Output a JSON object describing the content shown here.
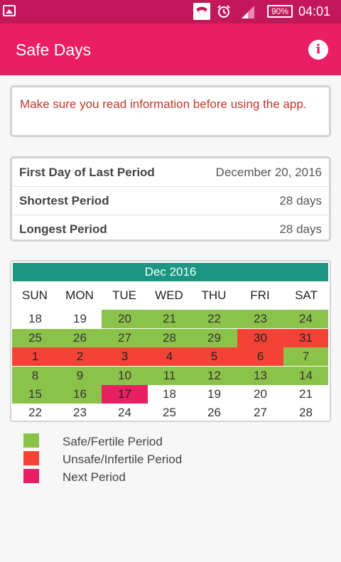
{
  "status_bar": {
    "battery": "90%",
    "time": "04:01",
    "icons": [
      "image-icon",
      "wifi-icon",
      "alarm-icon",
      "signal-icon",
      "battery-icon"
    ]
  },
  "app_bar": {
    "title": "Safe Days",
    "info_icon": "info-icon",
    "info_glyph": "i"
  },
  "notice": {
    "text": "Make sure you read information before using the app."
  },
  "details": [
    {
      "label": "First Day of Last Period",
      "value": "December 20, 2016"
    },
    {
      "label": "Shortest Period",
      "value": "28 days"
    },
    {
      "label": "Longest Period",
      "value": "28 days"
    }
  ],
  "calendar": {
    "month": "Dec 2016",
    "header_color": "#1a9683",
    "days_of_week": [
      "SUN",
      "MON",
      "TUE",
      "WED",
      "THU",
      "FRI",
      "SAT"
    ],
    "weeks": [
      [
        {
          "d": "18",
          "s": "none"
        },
        {
          "d": "19",
          "s": "none"
        },
        {
          "d": "20",
          "s": "safe"
        },
        {
          "d": "21",
          "s": "safe"
        },
        {
          "d": "22",
          "s": "safe"
        },
        {
          "d": "23",
          "s": "safe"
        },
        {
          "d": "24",
          "s": "safe"
        }
      ],
      [
        {
          "d": "25",
          "s": "safe"
        },
        {
          "d": "26",
          "s": "safe"
        },
        {
          "d": "27",
          "s": "safe"
        },
        {
          "d": "28",
          "s": "safe"
        },
        {
          "d": "29",
          "s": "safe"
        },
        {
          "d": "30",
          "s": "unsafe"
        },
        {
          "d": "31",
          "s": "unsafe"
        }
      ],
      [
        {
          "d": "1",
          "s": "unsafe"
        },
        {
          "d": "2",
          "s": "unsafe"
        },
        {
          "d": "3",
          "s": "unsafe"
        },
        {
          "d": "4",
          "s": "unsafe"
        },
        {
          "d": "5",
          "s": "unsafe"
        },
        {
          "d": "6",
          "s": "unsafe"
        },
        {
          "d": "7",
          "s": "safe"
        }
      ],
      [
        {
          "d": "8",
          "s": "safe"
        },
        {
          "d": "9",
          "s": "safe"
        },
        {
          "d": "10",
          "s": "safe"
        },
        {
          "d": "11",
          "s": "safe"
        },
        {
          "d": "12",
          "s": "safe"
        },
        {
          "d": "13",
          "s": "safe"
        },
        {
          "d": "14",
          "s": "safe"
        }
      ],
      [
        {
          "d": "15",
          "s": "safe"
        },
        {
          "d": "16",
          "s": "safe"
        },
        {
          "d": "17",
          "s": "next"
        },
        {
          "d": "18",
          "s": "none"
        },
        {
          "d": "19",
          "s": "none"
        },
        {
          "d": "20",
          "s": "none"
        },
        {
          "d": "21",
          "s": "none"
        }
      ],
      [
        {
          "d": "22",
          "s": "none"
        },
        {
          "d": "23",
          "s": "none"
        },
        {
          "d": "24",
          "s": "none"
        },
        {
          "d": "25",
          "s": "none"
        },
        {
          "d": "26",
          "s": "none"
        },
        {
          "d": "27",
          "s": "none"
        },
        {
          "d": "28",
          "s": "none"
        }
      ]
    ]
  },
  "legend": [
    {
      "label": "Safe/Fertile Period",
      "color": "#8bc34a"
    },
    {
      "label": "Unsafe/Infertile Period",
      "color": "#f44336"
    },
    {
      "label": "Next Period",
      "color": "#e91e63"
    }
  ],
  "colors": {
    "status_bar": "#c2185b",
    "app_bar": "#e91e63",
    "safe": "#8bc34a",
    "unsafe": "#f44336",
    "next": "#e91e63"
  }
}
